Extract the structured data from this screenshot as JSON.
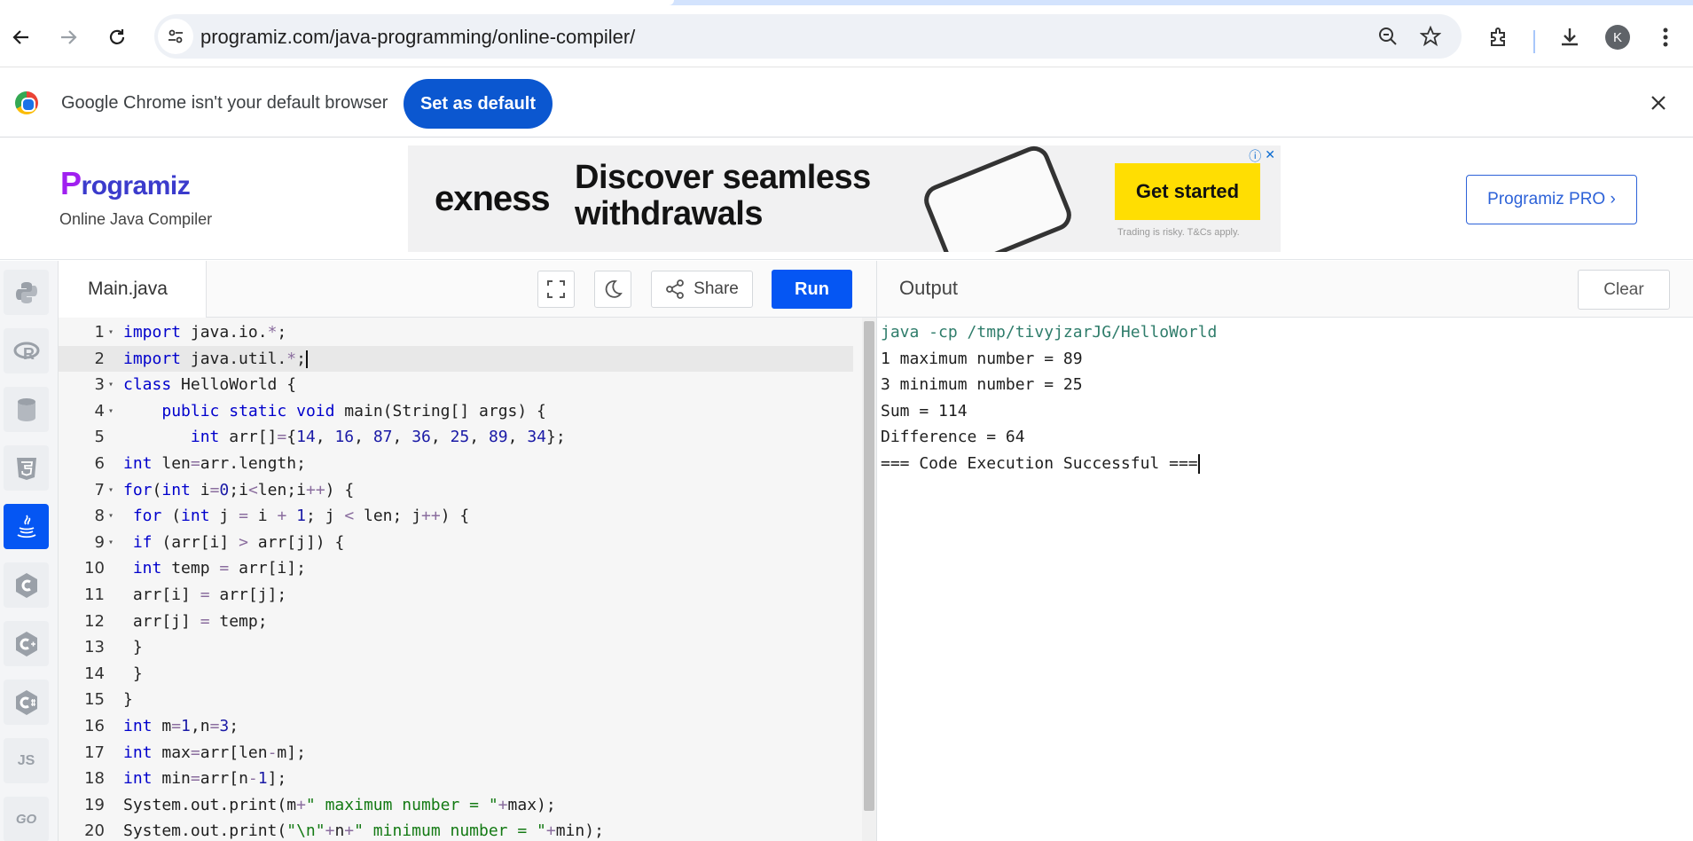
{
  "browser": {
    "url": "programiz.com/java-programming/online-compiler/",
    "avatar_letter": "K",
    "infobar_text": "Google Chrome isn't your default browser",
    "set_default_label": "Set as default"
  },
  "site": {
    "logo_text": "rogramiz",
    "logo_initial": "P",
    "subtitle": "Online Java Compiler",
    "pro_button": "Programiz PRO ›"
  },
  "ad": {
    "brand": "exness",
    "headline_line1": "Discover seamless",
    "headline_line2": "withdrawals",
    "cta": "Get started",
    "fine_print": "Trading is risky. T&Cs apply."
  },
  "rail": {
    "items": [
      "python",
      "r",
      "sql",
      "html",
      "java",
      "c",
      "cpp",
      "csharp",
      "js",
      "go"
    ],
    "active": "java",
    "js_label": "JS",
    "go_label": "GO"
  },
  "editor": {
    "file_tab": "Main.java",
    "share_label": "Share",
    "run_label": "Run",
    "highlighted_line": 2,
    "lines": [
      "import java.io.*;",
      "import java.util.*;",
      "class HelloWorld {",
      "    public static void main(String[] args) {",
      "       int arr[]={14, 16, 87, 36, 25, 89, 34};",
      "int len=arr.length;",
      "for(int i=0;i<len;i++) {",
      " for (int j = i + 1; j < len; j++) {",
      " if (arr[i] > arr[j]) {",
      " int temp = arr[i];",
      " arr[i] = arr[j];",
      " arr[j] = temp;",
      " }",
      " }",
      "}",
      "int m=1,n=3;",
      "int max=arr[len-m];",
      "int min=arr[n-1];",
      "System.out.print(m+\" maximum number = \"+max);",
      "System.out.print(\"\\n\"+n+\" minimum number = \"+min);"
    ],
    "fold_lines": [
      1,
      3,
      4,
      7,
      8,
      9
    ]
  },
  "output": {
    "title": "Output",
    "clear_label": "Clear",
    "lines": [
      "java -cp /tmp/tivyjzarJG/HelloWorld",
      "1 maximum number = 89",
      "3 minimum number = 25",
      "Sum = 114",
      "Difference = 64",
      "=== Code Execution Successful ==="
    ]
  }
}
